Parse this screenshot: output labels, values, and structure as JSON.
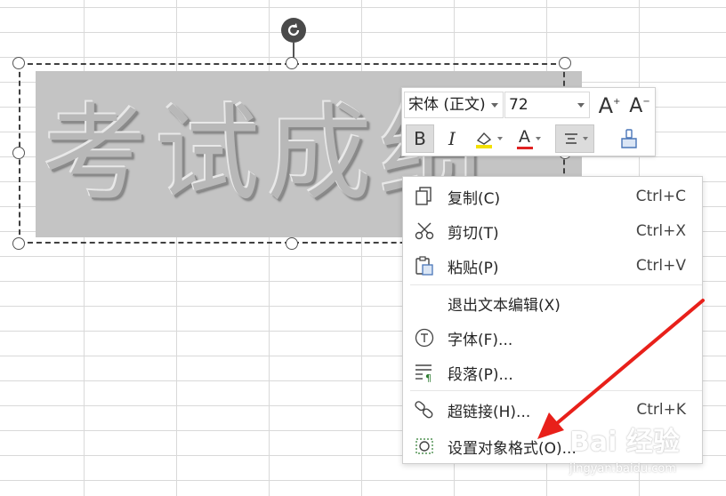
{
  "wordart": {
    "text": "考试成绩"
  },
  "toolbar": {
    "font_name": "宋体 (正文)",
    "font_size": "72",
    "increase_font_label": "A",
    "decrease_font_label": "A",
    "bold_label": "B",
    "italic_label": "I",
    "font_color_label": "A",
    "accent_colors": {
      "font_color": "#e02020",
      "highlight": "#f3e000"
    }
  },
  "context_menu": {
    "items": [
      {
        "label": "复制(C)",
        "shortcut": "Ctrl+C",
        "icon": "copy-icon"
      },
      {
        "label": "剪切(T)",
        "shortcut": "Ctrl+X",
        "icon": "scissors-icon"
      },
      {
        "label": "粘贴(P)",
        "shortcut": "Ctrl+V",
        "icon": "paste-icon"
      },
      {
        "label": "退出文本编辑(X)",
        "shortcut": "",
        "icon": ""
      },
      {
        "label": "字体(F)...",
        "shortcut": "",
        "icon": "font-icon"
      },
      {
        "label": "段落(P)...",
        "shortcut": "",
        "icon": "paragraph-icon"
      },
      {
        "label": "超链接(H)...",
        "shortcut": "Ctrl+K",
        "icon": "link-icon"
      },
      {
        "label": "设置对象格式(O)...",
        "shortcut": "",
        "icon": "format-object-icon"
      }
    ]
  },
  "watermark": {
    "brand": "Bai 经验",
    "url": "jingyan.baidu.com"
  },
  "annotation": {
    "arrow_color": "#e8201a"
  }
}
